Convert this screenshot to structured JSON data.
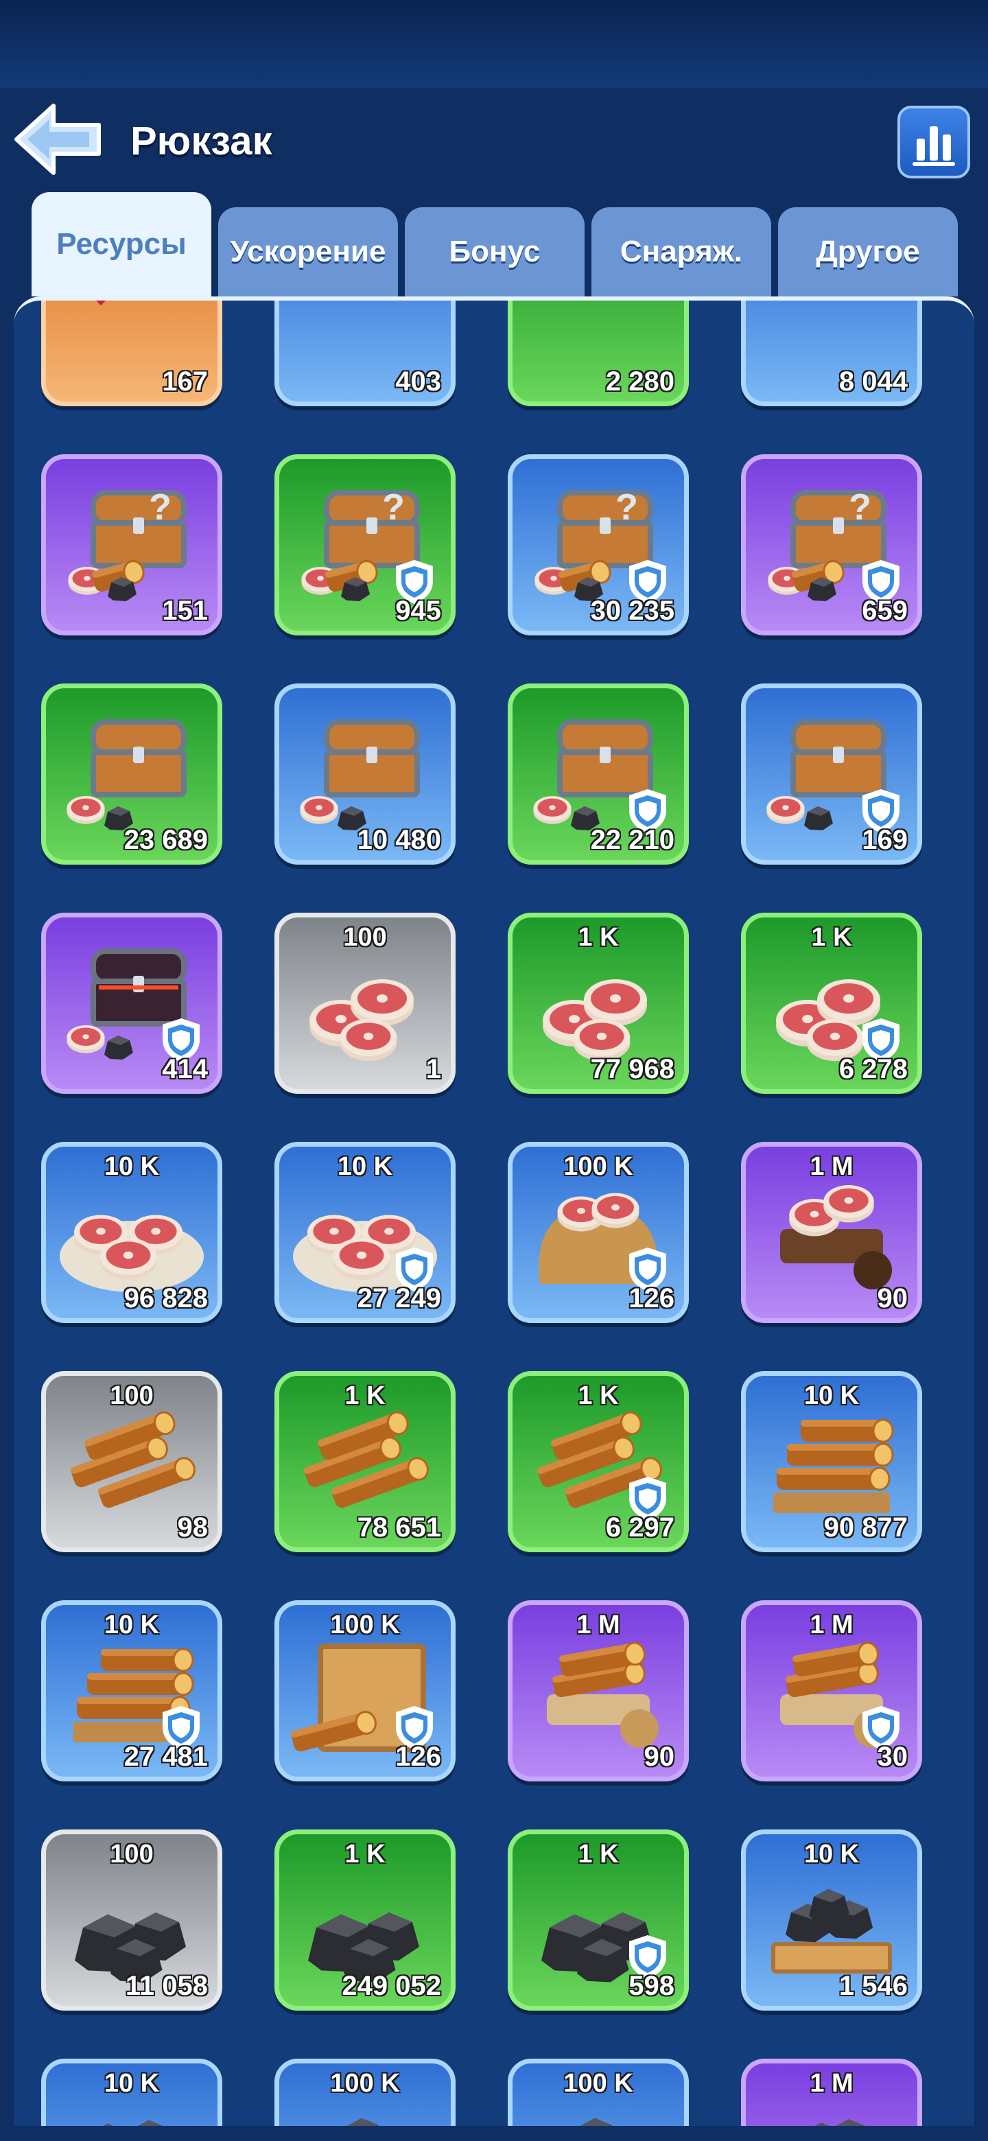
{
  "header": {
    "title": "Рюкзак"
  },
  "tabs": [
    "Ресурсы",
    "Ускорение",
    "Бонус",
    "Снаряж.",
    "Другое"
  ],
  "active_tab": "Ресурсы",
  "items": [
    {
      "art": "gem",
      "rarity": "orange",
      "count": "167",
      "denom": "",
      "shield": false
    },
    {
      "art": "can",
      "rarity": "blue",
      "count": "403",
      "denom": "",
      "shield": false
    },
    {
      "art": "bundle",
      "rarity": "green",
      "count": "2 280",
      "denom": "",
      "shield": false
    },
    {
      "art": "bundle",
      "rarity": "blue",
      "count": "8 044",
      "denom": "",
      "shield": false
    },
    {
      "art": "mystery-chest",
      "rarity": "purple",
      "count": "151",
      "denom": "",
      "shield": false
    },
    {
      "art": "mystery-chest",
      "rarity": "green",
      "count": "945",
      "denom": "",
      "shield": true
    },
    {
      "art": "mystery-chest",
      "rarity": "blue",
      "count": "30 235",
      "denom": "",
      "shield": true
    },
    {
      "art": "mystery-chest",
      "rarity": "purple",
      "count": "659",
      "denom": "",
      "shield": true
    },
    {
      "art": "chest",
      "rarity": "green",
      "count": "23 689",
      "denom": "",
      "shield": false
    },
    {
      "art": "chest",
      "rarity": "blue",
      "count": "10 480",
      "denom": "",
      "shield": false
    },
    {
      "art": "chest",
      "rarity": "green",
      "count": "22 210",
      "denom": "",
      "shield": true
    },
    {
      "art": "chest",
      "rarity": "blue",
      "count": "169",
      "denom": "",
      "shield": true
    },
    {
      "art": "dark-chest",
      "rarity": "purple",
      "count": "414",
      "denom": "",
      "shield": true
    },
    {
      "art": "meat",
      "rarity": "gray",
      "count": "1",
      "denom": "100",
      "shield": false
    },
    {
      "art": "meat",
      "rarity": "green",
      "count": "77 968",
      "denom": "1 K",
      "shield": false
    },
    {
      "art": "meat",
      "rarity": "green",
      "count": "6 278",
      "denom": "1 K",
      "shield": true
    },
    {
      "art": "meat-plate",
      "rarity": "blue",
      "count": "96 828",
      "denom": "10 K",
      "shield": false
    },
    {
      "art": "meat-plate",
      "rarity": "blue",
      "count": "27 249",
      "denom": "10 K",
      "shield": true
    },
    {
      "art": "meat-sack",
      "rarity": "blue",
      "count": "126",
      "denom": "100 K",
      "shield": true
    },
    {
      "art": "meat-cart",
      "rarity": "purple",
      "count": "90",
      "denom": "1 M",
      "shield": false
    },
    {
      "art": "wood",
      "rarity": "gray",
      "count": "98",
      "denom": "100",
      "shield": false
    },
    {
      "art": "wood",
      "rarity": "green",
      "count": "78 651",
      "denom": "1 K",
      "shield": false
    },
    {
      "art": "wood",
      "rarity": "green",
      "count": "6 297",
      "denom": "1 K",
      "shield": true
    },
    {
      "art": "wood-pile",
      "rarity": "blue",
      "count": "90 877",
      "denom": "10 K",
      "shield": false
    },
    {
      "art": "wood-pile",
      "rarity": "blue",
      "count": "27 481",
      "denom": "10 K",
      "shield": true
    },
    {
      "art": "wood-crate",
      "rarity": "blue",
      "count": "126",
      "denom": "100 K",
      "shield": true
    },
    {
      "art": "wood-cart",
      "rarity": "purple",
      "count": "90",
      "denom": "1 M",
      "shield": false
    },
    {
      "art": "wood-cart",
      "rarity": "purple",
      "count": "30",
      "denom": "1 M",
      "shield": true
    },
    {
      "art": "coal",
      "rarity": "gray",
      "count": "11 058",
      "denom": "100",
      "shield": false
    },
    {
      "art": "coal",
      "rarity": "green",
      "count": "249 052",
      "denom": "1 K",
      "shield": false
    },
    {
      "art": "coal",
      "rarity": "green",
      "count": "598",
      "denom": "1 K",
      "shield": true
    },
    {
      "art": "coal-crate",
      "rarity": "blue",
      "count": "1 546",
      "denom": "10 K",
      "shield": false
    },
    {
      "art": "coal-pile",
      "rarity": "blue",
      "count": "",
      "denom": "10 K",
      "shield": false
    },
    {
      "art": "coal-crate",
      "rarity": "blue",
      "count": "",
      "denom": "100 K",
      "shield": false
    },
    {
      "art": "coal-crate",
      "rarity": "blue",
      "count": "",
      "denom": "100 K",
      "shield": false
    },
    {
      "art": "coal-cart",
      "rarity": "purple",
      "count": "",
      "denom": "1 M",
      "shield": false
    }
  ]
}
